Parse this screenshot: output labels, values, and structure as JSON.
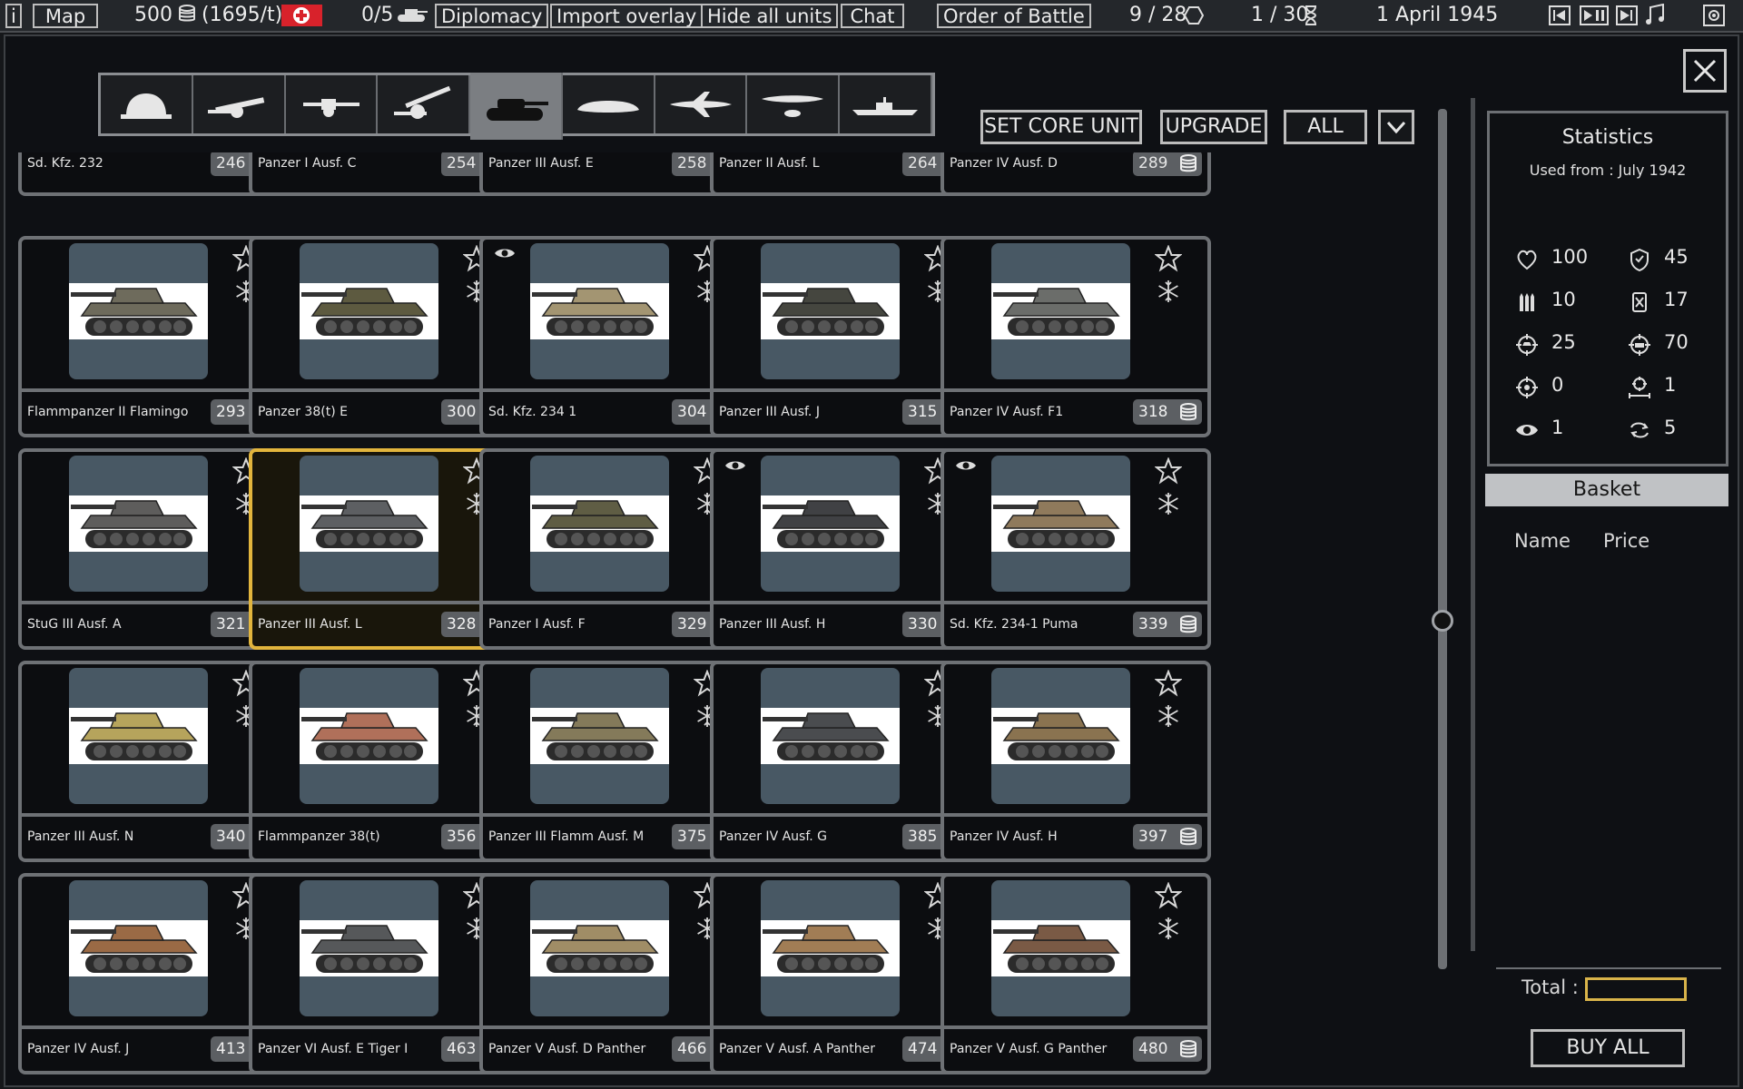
{
  "topbar": {
    "info_label": "i",
    "map_label": "Map",
    "prestige": "500",
    "prestige_income": "(1695/t)",
    "units": "0/5",
    "diplomacy_label": "Diplomacy",
    "import_label": "Import overlay",
    "hide_label": "Hide all units",
    "chat_label": "Chat",
    "oob_label": "Order of Battle",
    "hexes": "9 / 28",
    "turn": "1 / 30",
    "date": "1 April 1945"
  },
  "tabs": [
    "infantry",
    "towed-artillery",
    "anti-tank",
    "artillery",
    "tank",
    "recon",
    "fighter",
    "bomber",
    "ship"
  ],
  "active_tab": "tank",
  "actions": {
    "set_core": "SET CORE UNIT",
    "upgrade": "UPGRADE",
    "filter": "ALL"
  },
  "partial_row": [
    {
      "name": "Sd. Kfz. 232",
      "price": "246"
    },
    {
      "name": "Panzer I Ausf. C",
      "price": "254"
    },
    {
      "name": "Panzer III Ausf. E",
      "price": "258"
    },
    {
      "name": "Panzer II Ausf. L",
      "price": "264"
    },
    {
      "name": "Panzer IV Ausf. D",
      "price": "289"
    }
  ],
  "units": [
    {
      "name": "Flammpanzer II Flamingo",
      "price": "293",
      "color": "#6e6b5c",
      "eye": false,
      "selected": false
    },
    {
      "name": "Panzer 38(t) E",
      "price": "300",
      "color": "#5d5a40",
      "eye": false,
      "selected": false
    },
    {
      "name": "Sd. Kfz. 234 1",
      "price": "304",
      "color": "#a39572",
      "eye": true,
      "selected": false
    },
    {
      "name": "Panzer III Ausf. J",
      "price": "315",
      "color": "#45463f",
      "eye": false,
      "selected": false
    },
    {
      "name": "Panzer IV Ausf. F1",
      "price": "318",
      "color": "#6b6d6a",
      "eye": false,
      "selected": false
    },
    {
      "name": "StuG III Ausf. A",
      "price": "321",
      "color": "#5e5d5c",
      "eye": false,
      "selected": false
    },
    {
      "name": "Panzer III Ausf. L",
      "price": "328",
      "color": "#5d5f62",
      "eye": false,
      "selected": true
    },
    {
      "name": "Panzer I Ausf. F",
      "price": "329",
      "color": "#5f5d44",
      "eye": false,
      "selected": false
    },
    {
      "name": "Panzer III Ausf. H",
      "price": "330",
      "color": "#404144",
      "eye": true,
      "selected": false
    },
    {
      "name": "Sd. Kfz. 234-1 Puma",
      "price": "339",
      "color": "#8f7a5c",
      "eye": true,
      "selected": false
    },
    {
      "name": "Panzer III Ausf. N",
      "price": "340",
      "color": "#b6a45c",
      "eye": false,
      "selected": false
    },
    {
      "name": "Flammpanzer 38(t)",
      "price": "356",
      "color": "#b0705a",
      "eye": false,
      "selected": false
    },
    {
      "name": "Panzer III Flamm Ausf. M",
      "price": "375",
      "color": "#847a5a",
      "eye": false,
      "selected": false
    },
    {
      "name": "Panzer IV Ausf. G",
      "price": "385",
      "color": "#4a4c4f",
      "eye": false,
      "selected": false
    },
    {
      "name": "Panzer IV Ausf. H",
      "price": "397",
      "color": "#8a7350",
      "eye": false,
      "selected": false
    },
    {
      "name": "Panzer IV Ausf. J",
      "price": "413",
      "color": "#9a6a45",
      "eye": false,
      "selected": false
    },
    {
      "name": "Panzer VI Ausf. E Tiger I",
      "price": "463",
      "color": "#56585a",
      "eye": false,
      "selected": false
    },
    {
      "name": "Panzer V Ausf. D Panther",
      "price": "466",
      "color": "#a08d66",
      "eye": false,
      "selected": false
    },
    {
      "name": "Panzer V Ausf. A Panther",
      "price": "474",
      "color": "#a17d55",
      "eye": false,
      "selected": false
    },
    {
      "name": "Panzer V Ausf. G Panther",
      "price": "480",
      "color": "#7a5a45",
      "eye": false,
      "selected": false
    }
  ],
  "stats": {
    "title": "Statistics",
    "used_from": "Used from : July 1942",
    "values": [
      {
        "icon": "heart-icon",
        "value": "100"
      },
      {
        "icon": "shield-icon",
        "value": "45"
      },
      {
        "icon": "ammo-icon",
        "value": "10"
      },
      {
        "icon": "fuel-icon",
        "value": "17"
      },
      {
        "icon": "crosshair-icon",
        "value": "25"
      },
      {
        "icon": "crosshair-tank-icon",
        "value": "70"
      },
      {
        "icon": "target-icon",
        "value": "0"
      },
      {
        "icon": "range-icon",
        "value": "1"
      },
      {
        "icon": "eye-icon",
        "value": "1"
      },
      {
        "icon": "move-icon",
        "value": "5"
      }
    ]
  },
  "basket": {
    "title": "Basket",
    "name_col": "Name",
    "price_col": "Price",
    "total_label": "Total :",
    "buy_all": "BUY ALL"
  }
}
